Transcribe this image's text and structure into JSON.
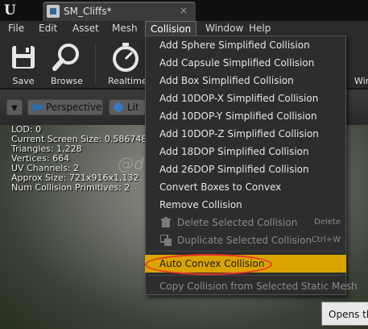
{
  "titlebar": {
    "tab_title": "SM_Cliffs*",
    "close_glyph": "×"
  },
  "menubar": {
    "items": [
      "File",
      "Edit",
      "Asset",
      "Mesh",
      "Collision",
      "Window",
      "Help"
    ],
    "active": "Collision"
  },
  "toolbar": {
    "save_label": "Save",
    "browse_label": "Browse",
    "realtime_label": "Realtime",
    "right_label": "Wir"
  },
  "viewport": {
    "perspective_label": "Perspective",
    "lit_label": "Lit",
    "stats": [
      "LOD:  0",
      "Current Screen Size:  0.586748",
      "Triangles:  1,228",
      "Vertices:  664",
      "UV Channels:  2",
      "Approx Size:  721x916x1,132",
      "Num Collision Primitives:  2"
    ],
    "watermark": "@dawn_arc",
    "tooltip": "Opens the"
  },
  "collision_menu": {
    "items": [
      "Add Sphere Simplified Collision",
      "Add Capsule Simplified Collision",
      "Add Box Simplified Collision",
      "Add 10DOP-X Simplified Collision",
      "Add 10DOP-Y Simplified Collision",
      "Add 10DOP-Z Simplified Collision",
      "Add 18DOP Simplified Collision",
      "Add 26DOP Simplified Collision",
      "Convert Boxes to Convex",
      "Remove Collision"
    ],
    "delete_label": "Delete Selected Collision",
    "delete_shortcut": "Delete",
    "duplicate_label": "Duplicate Selected Collision",
    "duplicate_shortcut": "Ctrl+W",
    "auto_convex_label": "Auto Convex Collision",
    "copy_label": "Copy Collision from Selected Static Mesh"
  },
  "colors": {
    "highlight": "#d9a400",
    "annotation_ring": "#e8332a"
  }
}
